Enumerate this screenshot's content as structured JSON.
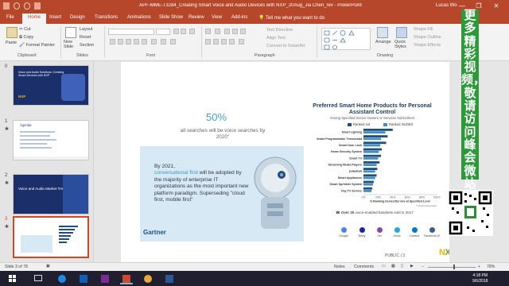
{
  "window": {
    "title": "APF-MME-T3284_Creating Smart Voice and Audio Devices with NXP_20Aug_Jia Chen_rev - PowerPoint",
    "user": "Lucas Wo",
    "controls": [
      "—",
      "❐",
      "✕"
    ]
  },
  "tabs": [
    "File",
    "Home",
    "Insert",
    "Design",
    "Transitions",
    "Animations",
    "Slide Show",
    "Review",
    "View",
    "Add-ins"
  ],
  "active_tab": "Home",
  "tell_me": "Tell me what you want to do",
  "ribbon": {
    "clipboard": {
      "paste": "Paste",
      "cut": "Cut",
      "copy": "Copy",
      "format_painter": "Format Painter",
      "label": "Clipboard"
    },
    "slides": {
      "new_slide": "New Slide",
      "layout": "Layout",
      "reset": "Reset",
      "section": "Section",
      "label": "Slides"
    },
    "font": {
      "label": "Font"
    },
    "paragraph": {
      "text_direction": "Text Direction",
      "align_text": "Align Text",
      "smartart": "Convert to SmartArt",
      "label": "Paragraph"
    },
    "drawing": {
      "arrange": "Arrange",
      "quick_styles": "Quick Styles",
      "shape_fill": "Shape Fill",
      "shape_outline": "Shape Outline",
      "shape_effects": "Shape Effects",
      "label": "Drawing"
    }
  },
  "thumbnails": [
    {
      "num": "0",
      "title": "Voice and Audio Solutions: Creating Smart Devices with NXP",
      "logo": "NXP"
    },
    {
      "num": "1",
      "title": "Agenda",
      "logo": ""
    },
    {
      "num": "2",
      "title": "Voice and Audio Market Trends",
      "logo": ""
    },
    {
      "num": "3",
      "title": "",
      "logo": ""
    }
  ],
  "slide": {
    "percent": "50%",
    "percent_text": "all searches will be voice searches by 2020\"",
    "quote_prefix": "By 2021,",
    "quote_highlight": "conversational first",
    "quote_rest": "will be adopted by the majority of enterprise IT organizations as the most important new platform paradigm. Superseding \"cloud first, mobile first\"",
    "source": "Gartner",
    "footnote_num": "Over 30",
    "footnote_text": "voice-enabled handsets sold in 2017",
    "page": "PUBLIC  |  3",
    "logo": "NXP"
  },
  "assistants": [
    {
      "name": "Google",
      "color": "#4285f4"
    },
    {
      "name": "Bixby",
      "color": "#1428a0"
    },
    {
      "name": "Siri",
      "color": "#8e44ad"
    },
    {
      "name": "Alexa",
      "color": "#23a8e0"
    },
    {
      "name": "Cortana",
      "color": "#0078d7"
    },
    {
      "name": "Facebook M",
      "color": "#3b5998"
    }
  ],
  "chart_data": {
    "type": "bar",
    "title": "Preferred Smart Home Products for Personal Assistant Control",
    "subtitle": "Among Specified Device Owners or Services Subscribers",
    "categories": [
      "Smart Lighting",
      "Smart Programmable Thermostat",
      "Smart Door Lock",
      "Home Security System",
      "Smart TV",
      "Streaming Media Players",
      "DVR/PVR",
      "Smart Appliances",
      "Smart Sprinkler System",
      "Pay TV Service"
    ],
    "series": [
      {
        "name": "Ranked 1st",
        "color": "#1f4e79",
        "values": [
          40,
          33,
          31,
          25,
          24,
          22,
          19,
          18,
          14,
          12
        ]
      },
      {
        "name": "Ranked 2nd/3rd",
        "color": "#3f8fc4",
        "values": [
          30,
          24,
          23,
          21,
          20,
          18,
          16,
          16,
          13,
          11
        ]
      }
    ],
    "xlabel": "% Ranking Device/Service at Specified Level",
    "xticks": [
      "0%",
      "20%",
      "40%",
      "60%",
      "80%",
      "100%"
    ],
    "xlim": [
      0,
      100
    ],
    "source": "© Parks Associates"
  },
  "watermark": {
    "text": "更多精彩视频，敬请访问峰会微站"
  },
  "status": {
    "slide_info": "Slide 3 of 78",
    "notes": "Notes",
    "comments": "Comments",
    "zoom": "78%"
  },
  "taskbar": {
    "apps": [
      {
        "name": "Windows",
        "color": "#ffffff"
      },
      {
        "name": "Task View",
        "color": "#cfd8e6"
      },
      {
        "name": "Edge",
        "color": "#1e88e5"
      },
      {
        "name": "Outlook",
        "color": "#0f5fb8"
      },
      {
        "name": "OneNote",
        "color": "#7b2b92"
      },
      {
        "name": "PowerPoint",
        "color": "#c94b2b"
      },
      {
        "name": "Chrome",
        "color": "#e8a93a"
      },
      {
        "name": "Word",
        "color": "#2b579a"
      }
    ],
    "time": "4:18 PM",
    "date": "9/6/2018"
  }
}
